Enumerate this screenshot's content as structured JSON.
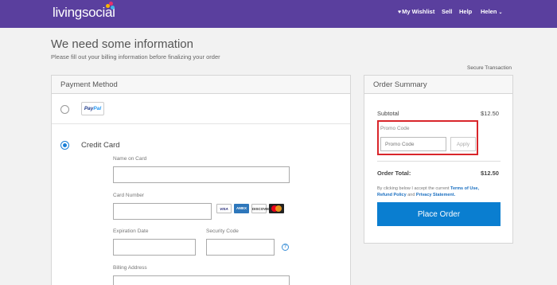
{
  "header": {
    "logo": "livingsocial",
    "wishlist": "My Wishlist",
    "sell": "Sell",
    "help": "Help",
    "user": "Helen",
    "colors": {
      "bar": "#5a3f9e"
    }
  },
  "page": {
    "title": "We need some information",
    "subtitle": "Please fill out your billing information before finalizing your order",
    "secure": "Secure Transaction"
  },
  "payment": {
    "heading": "Payment Method",
    "paypal": {
      "part1": "Pay",
      "part2": "Pal",
      "selected": false
    },
    "credit_card": {
      "label": "Credit Card",
      "selected": true
    },
    "fields": {
      "name_label": "Name on Card",
      "number_label": "Card Number",
      "expiration_label": "Expiration Date",
      "security_label": "Security Code",
      "billing_label": "Billing Address"
    },
    "cards": {
      "visa": "VISA",
      "amex": "AMEX",
      "discover": "DISCOVER"
    }
  },
  "summary": {
    "heading": "Order Summary",
    "subtotal_label": "Subtotal",
    "subtotal_value": "$12.50",
    "promo_label": "Promo Code",
    "promo_placeholder": "Promo Code",
    "apply": "Apply",
    "total_label": "Order Total:",
    "total_value": "$12.50",
    "terms_prefix": "By clicking below I accept the current ",
    "terms_link": "Terms of Use,",
    "refund_link": "Refund Policy",
    "terms_and": " and ",
    "privacy_link": "Privacy Statement.",
    "place_order": "Place Order",
    "colors": {
      "button": "#0a7ed0",
      "highlight": "#d9262b"
    }
  }
}
